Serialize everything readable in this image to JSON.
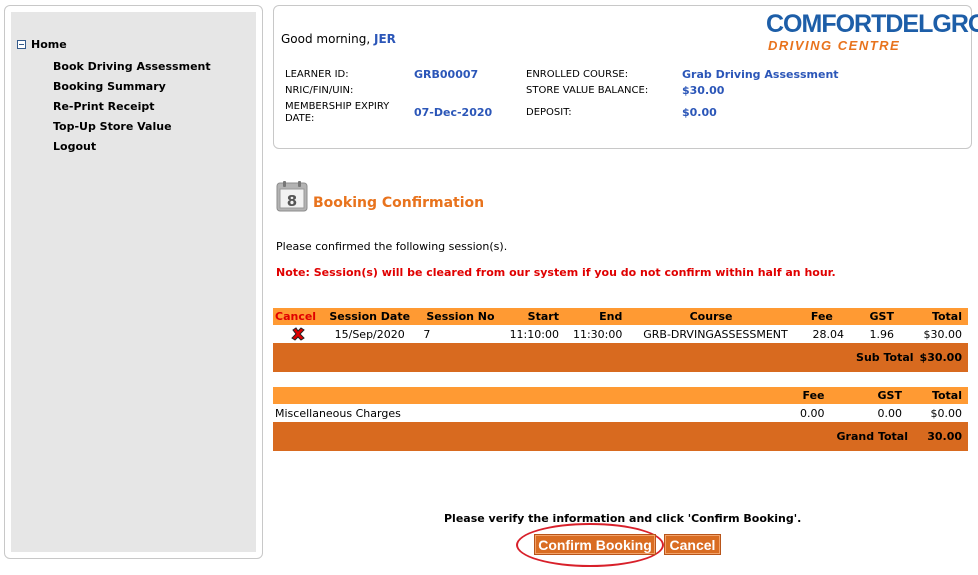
{
  "sidebar": {
    "home": "Home",
    "items": [
      {
        "label": "Book Driving Assessment"
      },
      {
        "label": "Booking Summary"
      },
      {
        "label": "Re-Print Receipt"
      },
      {
        "label": "Top-Up Store Value"
      },
      {
        "label": "Logout"
      }
    ]
  },
  "header": {
    "greeting": "Good morning,",
    "username": "JER",
    "logo_line1": "COMFORTDELGRO",
    "logo_line2": "DRIVING CENTRE",
    "learner_id_label": "LEARNER ID:",
    "learner_id": "GRB00007",
    "nric_label": "NRIC/FIN/UIN:",
    "membership_label_1": "MEMBERSHIP EXPIRY",
    "membership_label_2": "DATE:",
    "membership_expiry": "07-Dec-2020",
    "course_label": "ENROLLED COURSE:",
    "course": "Grab Driving Assessment",
    "balance_label": "STORE VALUE BALANCE:",
    "balance": "$30.00",
    "deposit_label": "DEPOSIT:",
    "deposit": "$0.00"
  },
  "booking": {
    "icon": "calendar-icon",
    "icon_number": "8",
    "title": "Booking Confirmation",
    "instruction": "Please confirmed the following session(s).",
    "note": "Note: Session(s) will be cleared from our system if you do not confirm within half an hour."
  },
  "sessions_table": {
    "headers": {
      "cancel": "Cancel",
      "date": "Session Date",
      "no": "Session No",
      "start": "Start",
      "end": "End",
      "course": "Course",
      "fee": "Fee",
      "gst": "GST",
      "total": "Total"
    },
    "rows": [
      {
        "date": "15/Sep/2020",
        "no": "7",
        "start": "11:10:00",
        "end": "11:30:00",
        "course": "GRB-DRVINGASSESSMENT",
        "fee": "28.04",
        "gst": "1.96",
        "total": "$30.00"
      }
    ],
    "subtotal_label": "Sub Total",
    "subtotal": "$30.00"
  },
  "misc_table": {
    "headers": {
      "fee": "Fee",
      "gst": "GST",
      "total": "Total"
    },
    "row": {
      "label": "Miscellaneous Charges",
      "fee": "0.00",
      "gst": "0.00",
      "total": "$0.00"
    },
    "grand_total_label": "Grand Total",
    "grand_total": "30.00"
  },
  "footer": {
    "verify_text": "Please verify the information and click 'Confirm Booking'.",
    "confirm_label": "Confirm Booking",
    "cancel_label": "Cancel"
  },
  "colors": {
    "accent_orange": "#e8731d",
    "header_orange": "#ff9a33",
    "dark_orange": "#d86a1f",
    "link_blue": "#2b56b8",
    "alert_red": "#e00000"
  }
}
